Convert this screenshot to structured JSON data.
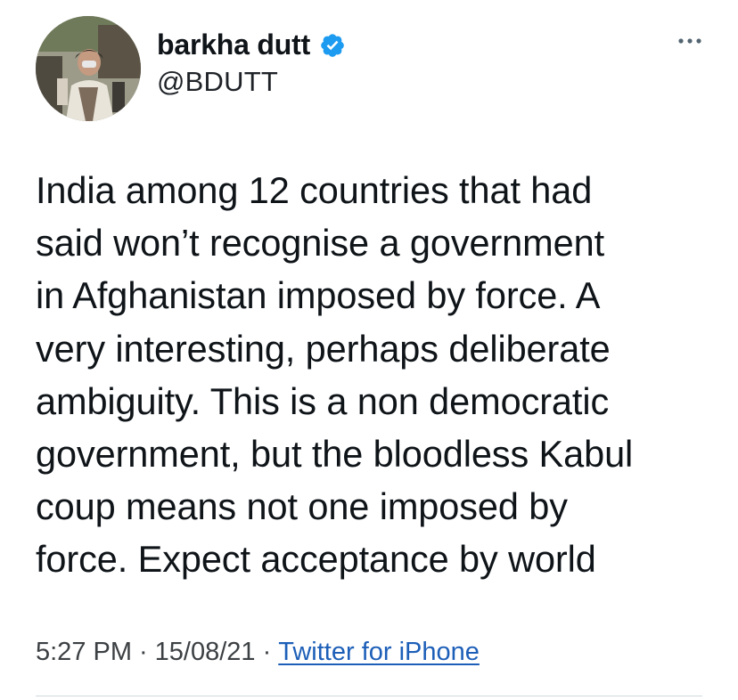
{
  "author": {
    "display_name": "barkha dutt",
    "handle": "@BDUTT",
    "avatar_icon": "profile-photo",
    "verified_icon": "verified-badge-icon",
    "verified_color": "#1d9bf0"
  },
  "menu": {
    "icon": "more-horizontal-icon"
  },
  "tweet": {
    "text": "India among 12 countries that had\nsaid won’t recognise a government\nin Afghanistan imposed by force. A\nvery interesting, perhaps deliberate\nambiguity. This is a non democratic\ngovernment, but the bloodless Kabul\ncoup means not one imposed by\nforce. Expect acceptance by world"
  },
  "meta": {
    "time": "5:27 PM",
    "date": "15/08/21",
    "separator": "·",
    "source": "Twitter for iPhone",
    "link_color": "#1d5fb8"
  }
}
